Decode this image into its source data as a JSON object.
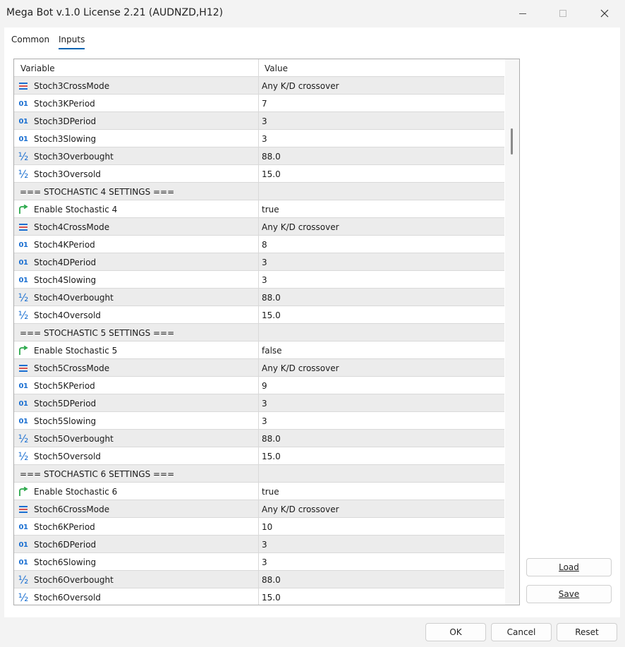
{
  "window": {
    "title": "Mega Bot v.1.0 License 2.21 (AUDNZD,H12)"
  },
  "tabs": [
    {
      "label": "Common"
    },
    {
      "label": "Inputs"
    }
  ],
  "grid": {
    "headers": {
      "variable": "Variable",
      "value": "Value"
    },
    "rows": [
      {
        "icon": "crossmode-icon",
        "name": "Stoch3CrossMode",
        "value": "Any K/D crossover"
      },
      {
        "icon": "integer-icon",
        "name": "Stoch3KPeriod",
        "value": "7"
      },
      {
        "icon": "integer-icon",
        "name": "Stoch3DPeriod",
        "value": "3"
      },
      {
        "icon": "integer-icon",
        "name": "Stoch3Slowing",
        "value": "3"
      },
      {
        "icon": "double-icon",
        "name": "Stoch3Overbought",
        "value": "88.0"
      },
      {
        "icon": "double-icon",
        "name": "Stoch3Oversold",
        "value": "15.0"
      },
      {
        "icon": "",
        "name": "=== STOCHASTIC 4 SETTINGS ===",
        "value": ""
      },
      {
        "icon": "bool-icon",
        "name": "Enable Stochastic 4",
        "value": "true"
      },
      {
        "icon": "crossmode-icon",
        "name": "Stoch4CrossMode",
        "value": "Any K/D crossover"
      },
      {
        "icon": "integer-icon",
        "name": "Stoch4KPeriod",
        "value": "8"
      },
      {
        "icon": "integer-icon",
        "name": "Stoch4DPeriod",
        "value": "3"
      },
      {
        "icon": "integer-icon",
        "name": "Stoch4Slowing",
        "value": "3"
      },
      {
        "icon": "double-icon",
        "name": "Stoch4Overbought",
        "value": "88.0"
      },
      {
        "icon": "double-icon",
        "name": "Stoch4Oversold",
        "value": "15.0"
      },
      {
        "icon": "",
        "name": "=== STOCHASTIC 5 SETTINGS ===",
        "value": ""
      },
      {
        "icon": "bool-icon",
        "name": "Enable Stochastic 5",
        "value": "false"
      },
      {
        "icon": "crossmode-icon",
        "name": "Stoch5CrossMode",
        "value": "Any K/D crossover"
      },
      {
        "icon": "integer-icon",
        "name": "Stoch5KPeriod",
        "value": "9"
      },
      {
        "icon": "integer-icon",
        "name": "Stoch5DPeriod",
        "value": "3"
      },
      {
        "icon": "integer-icon",
        "name": "Stoch5Slowing",
        "value": "3"
      },
      {
        "icon": "double-icon",
        "name": "Stoch5Overbought",
        "value": "88.0"
      },
      {
        "icon": "double-icon",
        "name": "Stoch5Oversold",
        "value": "15.0"
      },
      {
        "icon": "",
        "name": "=== STOCHASTIC 6 SETTINGS ===",
        "value": ""
      },
      {
        "icon": "bool-icon",
        "name": "Enable Stochastic 6",
        "value": "true"
      },
      {
        "icon": "crossmode-icon",
        "name": "Stoch6CrossMode",
        "value": "Any K/D crossover"
      },
      {
        "icon": "integer-icon",
        "name": "Stoch6KPeriod",
        "value": "10"
      },
      {
        "icon": "integer-icon",
        "name": "Stoch6DPeriod",
        "value": "3"
      },
      {
        "icon": "integer-icon",
        "name": "Stoch6Slowing",
        "value": "3"
      },
      {
        "icon": "double-icon",
        "name": "Stoch6Overbought",
        "value": "88.0"
      },
      {
        "icon": "double-icon",
        "name": "Stoch6Oversold",
        "value": "15.0"
      }
    ]
  },
  "side_buttons": {
    "load_label": "Load",
    "save_label": "Save"
  },
  "footer": {
    "ok_label": "OK",
    "cancel_label": "Cancel",
    "reset_label": "Reset"
  },
  "colors": {
    "accent": "#0063b1",
    "icon_blue": "#1a6fd1",
    "icon_green": "#2aa84a",
    "icon_red": "#d9534f"
  }
}
